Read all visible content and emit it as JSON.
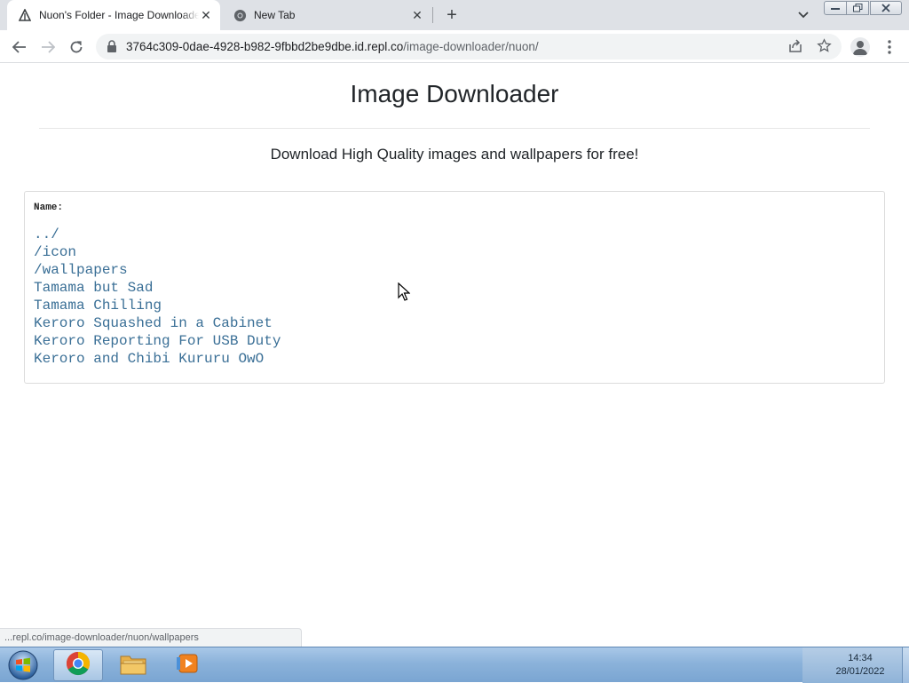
{
  "browser": {
    "tabs": [
      {
        "title": "Nuon's Folder - Image Downloader",
        "active": true,
        "icon": "repl-icon"
      },
      {
        "title": "New Tab",
        "active": false,
        "icon": "chrome-icon"
      }
    ],
    "url_host": "3764c309-0dae-4928-b982-9fbbd2be9dbe.id.repl.co",
    "url_path": "/image-downloader/nuon/",
    "status_url": "...repl.co/image-downloader/nuon/wallpapers"
  },
  "page": {
    "title": "Image Downloader",
    "subtitle": "Download High Quality images and wallpapers for free!",
    "listing": {
      "header": "Name:",
      "items": [
        "../",
        "/icon",
        "/wallpapers",
        "Tamama but Sad",
        "Tamama Chilling",
        "Keroro Squashed in a Cabinet",
        "Keroro Reporting For USB Duty",
        "Keroro and Chibi Kururu OwO"
      ]
    }
  },
  "taskbar": {
    "time": "14:34",
    "date": "28/01/2022",
    "apps": [
      "chrome-icon",
      "file-explorer-icon",
      "media-player-icon"
    ]
  },
  "colors": {
    "link": "#3a6f96",
    "tabstrip": "#dee1e6",
    "taskbar": "#8bb2da"
  }
}
